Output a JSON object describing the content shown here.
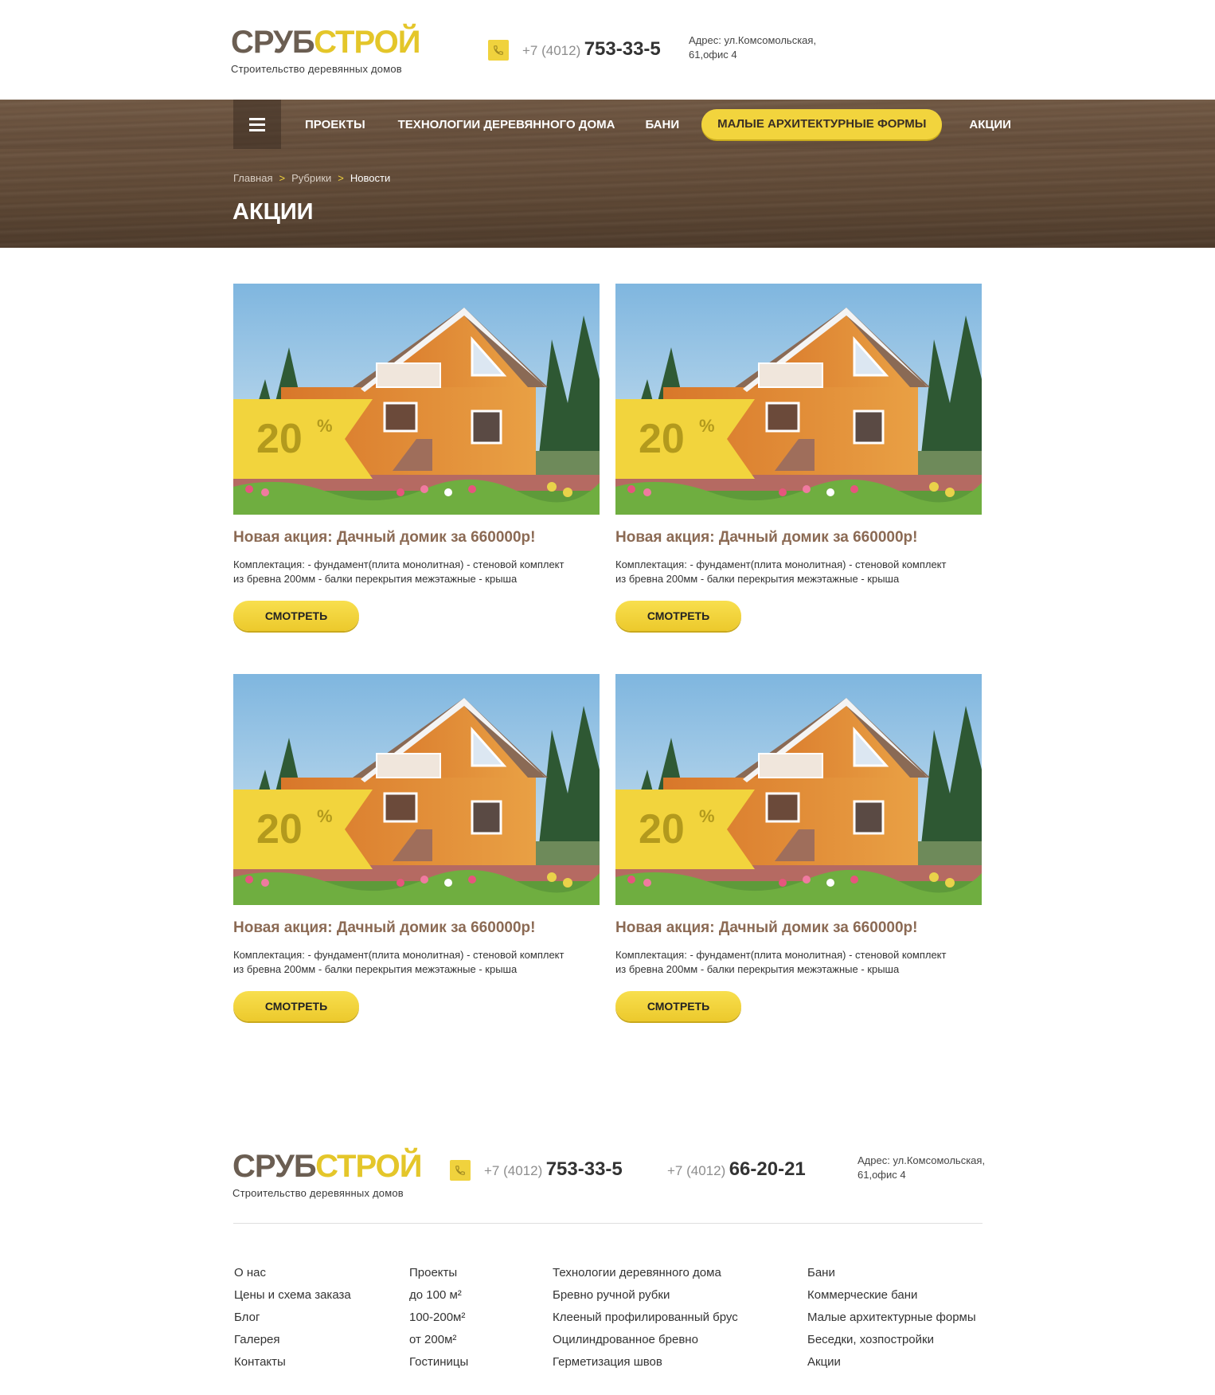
{
  "header": {
    "logo_part1": "СРУБ",
    "logo_part2": "СТРОЙ",
    "tagline": "Строительство деревянных домов",
    "phone_code": "+7 (4012)",
    "phone_number": "753-33-5",
    "address_line1": "Адрес: ул.Комсомольская,",
    "address_line2": "61,офис 4"
  },
  "nav": {
    "items": [
      "ПРОЕКТЫ",
      "ТЕХНОЛОГИИ ДЕРЕВЯННОГО ДОМА",
      "БАНИ",
      "МАЛЫЕ АРХИТЕКТУРНЫЕ ФОРМЫ",
      "АКЦИИ"
    ]
  },
  "breadcrumb": {
    "items": [
      "Главная",
      "Рубрики",
      "Новости"
    ],
    "separator": ">"
  },
  "page_title": "АКЦИИ",
  "cards": [
    {
      "discount": "20",
      "percent": "%",
      "title": "Новая акция: Дачный домик за 660000р!",
      "desc_line1": "Комплектация: - фундамент(плита монолитная) - стеновой комплект",
      "desc_line2": "из бревна 200мм - балки перекрытия межэтажные - крыша",
      "button": "СМОТРЕТЬ"
    },
    {
      "discount": "20",
      "percent": "%",
      "title": "Новая акция: Дачный домик за 660000р!",
      "desc_line1": "Комплектация: - фундамент(плита монолитная) - стеновой комплект",
      "desc_line2": "из бревна 200мм - балки перекрытия межэтажные - крыша",
      "button": "СМОТРЕТЬ"
    },
    {
      "discount": "20",
      "percent": "%",
      "title": "Новая акция: Дачный домик за 660000р!",
      "desc_line1": "Комплектация: - фундамент(плита монолитная) - стеновой комплект",
      "desc_line2": "из бревна 200мм - балки перекрытия межэтажные - крыша",
      "button": "СМОТРЕТЬ"
    },
    {
      "discount": "20",
      "percent": "%",
      "title": "Новая акция: Дачный домик за 660000р!",
      "desc_line1": "Комплектация: - фундамент(плита монолитная) - стеновой комплект",
      "desc_line2": "из бревна 200мм - балки перекрытия межэтажные - крыша",
      "button": "СМОТРЕТЬ"
    }
  ],
  "footer": {
    "logo_part1": "СРУБ",
    "logo_part2": "СТРОЙ",
    "tagline": "Строительство деревянных домов",
    "phone1_code": "+7 (4012)",
    "phone1_number": "753-33-5",
    "phone2_code": "+7 (4012)",
    "phone2_number": "66-20-21",
    "address_line1": "Адрес: ул.Комсомольская,",
    "address_line2": "61,офис 4",
    "columns": [
      [
        "О нас",
        "Цены и схема заказа",
        "Блог",
        "Галерея",
        "Контакты"
      ],
      [
        "Проекты",
        "до 100 м²",
        "100-200м²",
        "от 200м²",
        "Гостиницы"
      ],
      [
        "Технологии деревянного дома",
        "Бревно ручной рубки",
        "Клееный профилированный брус",
        "Оцилиндрованное бревно",
        "Герметизация швов"
      ],
      [
        "Бани",
        "Коммерческие бани",
        "Малые архитектурные формы",
        "Беседки, хозпостройки",
        "Акции"
      ]
    ]
  },
  "colors": {
    "accent_yellow": "#f2d43d",
    "logo_brown": "#6b5e52",
    "title_brown": "#8b6a54",
    "wood_bg": "#6a523e"
  },
  "icons": [
    "phone-icon",
    "hamburger-menu-icon"
  ]
}
